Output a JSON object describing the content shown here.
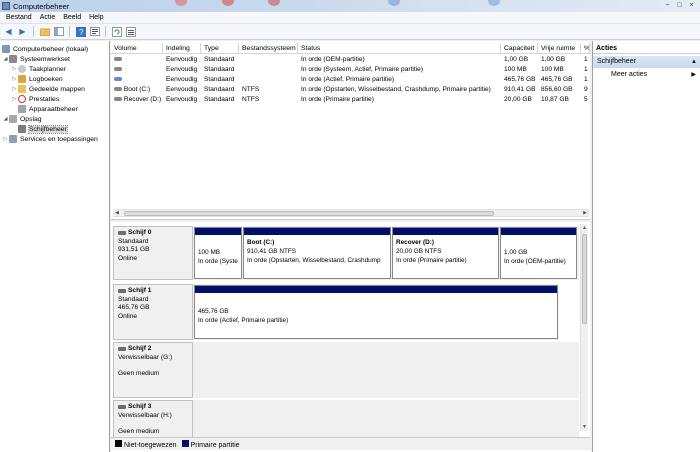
{
  "window": {
    "title": "Computerbeheer"
  },
  "menu": [
    "Bestand",
    "Actie",
    "Beeld",
    "Help"
  ],
  "tree": {
    "root": "Computerbeheer (lokaal)",
    "system_tools": "Systeemwerkset",
    "task_scheduler": "Taakplanner",
    "event_viewer": "Logboeken",
    "shared_folders": "Gedeelde mappen",
    "performance": "Prestaties",
    "device_manager": "Apparaatbeheer",
    "storage": "Opslag",
    "disk_management": "Schijfbeheer",
    "services": "Services en toepassingen"
  },
  "volume_table": {
    "headers": [
      "Volume",
      "Indeling",
      "Type",
      "Bestandssysteem",
      "Status",
      "Capaciteit",
      "Vrije ruimte",
      "%"
    ],
    "rows": [
      [
        "",
        "Eenvoudig",
        "Standaard",
        "",
        "In orde (OEM-partitie)",
        "1,00 GB",
        "1,00 GB",
        "1"
      ],
      [
        "",
        "Eenvoudig",
        "Standaard",
        "",
        "In orde (Systeem, Actief, Primaire partitie)",
        "100 MB",
        "100 MB",
        "1"
      ],
      [
        "",
        "Eenvoudig",
        "Standaard",
        "",
        "In orde (Actief, Primaire partitie)",
        "465,76 GB",
        "465,76 GB",
        "1"
      ],
      [
        "Boot (C:)",
        "Eenvoudig",
        "Standaard",
        "NTFS",
        "In orde (Opstarten, Wisselbestand, Crashdump, Primaire partitie)",
        "910,41 GB",
        "856,60 GB",
        "9"
      ],
      [
        "Recover (D:)",
        "Eenvoudig",
        "Standaard",
        "NTFS",
        "In orde (Primaire partitie)",
        "20,00 GB",
        "10,87 GB",
        "5"
      ]
    ]
  },
  "disks": [
    {
      "name": "Schijf 0",
      "kind": "Standaard",
      "size": "931,51 GB",
      "state": "Online",
      "partitions": [
        {
          "title": "",
          "line1": "100 MB",
          "line2": "In orde (Syste"
        },
        {
          "title": "Boot  (C:)",
          "line1": "910,41 GB NTFS",
          "line2": "In orde (Opstarten, Wisselbestand, Crashdump"
        },
        {
          "title": "Recover  (D:)",
          "line1": "20,00 GB NTFS",
          "line2": "In orde (Primaire partitie)"
        },
        {
          "title": "",
          "line1": "1,00 GB",
          "line2": "In orde (OEM-partitie)"
        }
      ]
    },
    {
      "name": "Schijf 1",
      "kind": "Standaard",
      "size": "465,76 GB",
      "state": "Online",
      "partitions": [
        {
          "title": "",
          "line1": "465,76 GB",
          "line2": "In orde (Actief, Primaire partitie)"
        }
      ]
    },
    {
      "name": "Schijf 2",
      "kind": "Verwisselbaar (G:)",
      "size": "",
      "state": "Geen medium",
      "partitions": []
    },
    {
      "name": "Schijf 3",
      "kind": "Verwisselbaar (H:)",
      "size": "",
      "state": "Geen medium",
      "partitions": []
    }
  ],
  "legend": [
    {
      "label": "Niet-toegewezen",
      "color": "#000000"
    },
    {
      "label": "Primaire partitie",
      "color": "#00106a"
    }
  ],
  "actions": {
    "header": "Acties",
    "section": "Schijfbeheer",
    "more": "Meer acties"
  },
  "colors": {
    "partition_bar": "#00106a",
    "selection": "#dcdcdc",
    "action_section": "#c7d8ee"
  }
}
